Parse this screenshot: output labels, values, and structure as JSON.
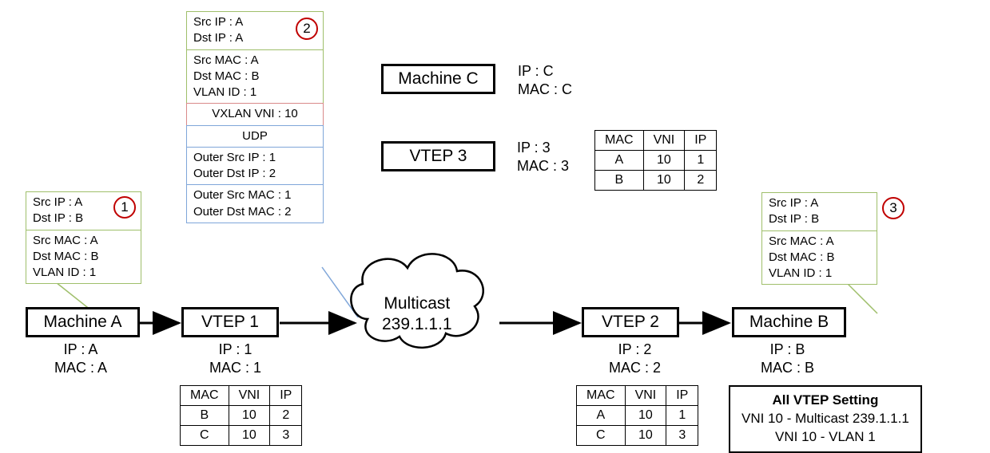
{
  "nodes": {
    "machineA": {
      "label": "Machine A",
      "ip": "IP : A",
      "mac": "MAC : A"
    },
    "vtep1": {
      "label": "VTEP 1",
      "ip": "IP : 1",
      "mac": "MAC : 1"
    },
    "machineC": {
      "label": "Machine C",
      "ip": "IP : C",
      "mac": "MAC : C"
    },
    "vtep3": {
      "label": "VTEP 3",
      "ip": "IP : 3",
      "mac": "MAC : 3"
    },
    "vtep2": {
      "label": "VTEP 2",
      "ip": "IP : 2",
      "mac": "MAC : 2"
    },
    "machineB": {
      "label": "Machine B",
      "ip": "IP : B",
      "mac": "MAC : B"
    }
  },
  "multicast": {
    "label": "Multicast",
    "ip": "239.1.1.1"
  },
  "packets": {
    "p1": {
      "badge": "1",
      "sec1": {
        "l1": "Src IP : A",
        "l2": "Dst IP : B"
      },
      "sec2": {
        "l1": "Src MAC : A",
        "l2": "Dst MAC : B",
        "l3": "VLAN ID : 1"
      }
    },
    "p2": {
      "badge": "2",
      "sec1": {
        "l1": "Src IP : A",
        "l2": "Dst IP : A"
      },
      "sec2": {
        "l1": "Src MAC : A",
        "l2": "Dst MAC : B",
        "l3": "VLAN ID : 1"
      },
      "sec3": "VXLAN VNI : 10",
      "sec4": "UDP",
      "sec5": {
        "l1": "Outer Src IP : 1",
        "l2": "Outer Dst IP : 2"
      },
      "sec6": {
        "l1": "Outer Src MAC : 1",
        "l2": "Outer Dst MAC : 2"
      }
    },
    "p3": {
      "badge": "3",
      "sec1": {
        "l1": "Src IP : A",
        "l2": "Dst IP : B"
      },
      "sec2": {
        "l1": "Src MAC : A",
        "l2": "Dst MAC : B",
        "l3": "VLAN ID : 1"
      }
    }
  },
  "tables": {
    "headers": {
      "mac": "MAC",
      "vni": "VNI",
      "ip": "IP"
    },
    "vtep1": [
      {
        "mac": "B",
        "vni": "10",
        "ip": "2"
      },
      {
        "mac": "C",
        "vni": "10",
        "ip": "3"
      }
    ],
    "vtep2": [
      {
        "mac": "A",
        "vni": "10",
        "ip": "1"
      },
      {
        "mac": "C",
        "vni": "10",
        "ip": "3"
      }
    ],
    "vtep3": [
      {
        "mac": "A",
        "vni": "10",
        "ip": "1"
      },
      {
        "mac": "B",
        "vni": "10",
        "ip": "2"
      }
    ]
  },
  "settings": {
    "title": "All VTEP Setting",
    "l1": "VNI 10 - Multicast 239.1.1.1",
    "l2": "VNI 10 - VLAN 1"
  }
}
